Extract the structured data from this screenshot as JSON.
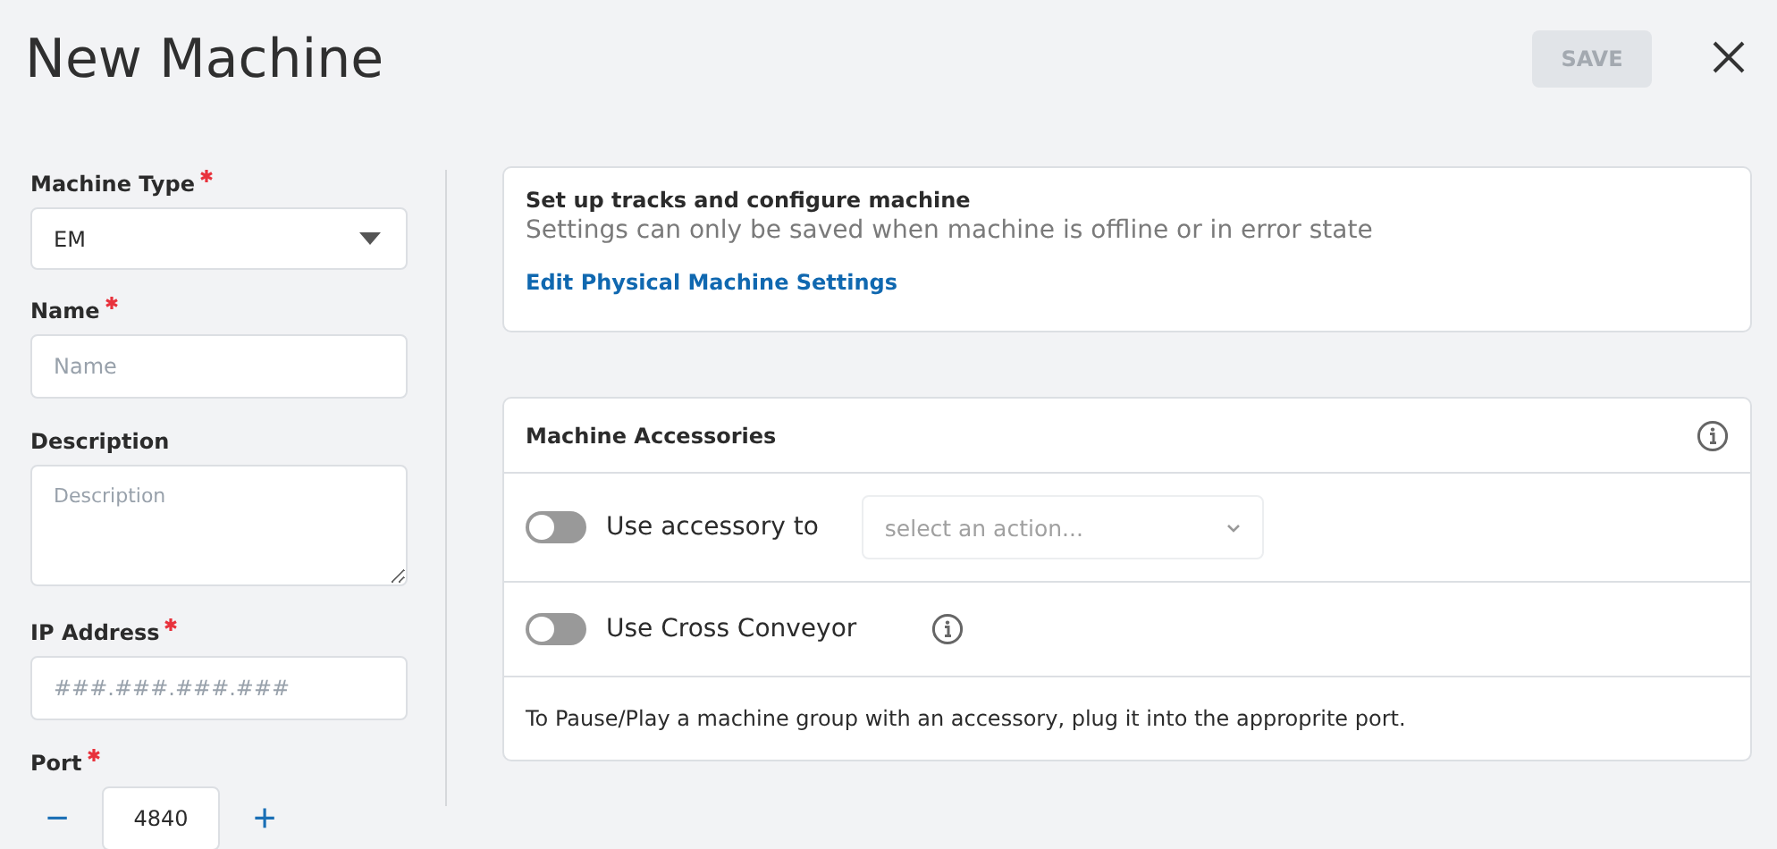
{
  "header": {
    "title": "New Machine",
    "save": {
      "label": "SAVE",
      "disabled": true
    }
  },
  "form": [
    {
      "kind": "select",
      "label": "Machine Type",
      "required": true,
      "value": "EM"
    },
    {
      "kind": "text",
      "label": "Name",
      "required": true,
      "placeholder": "Name"
    },
    {
      "kind": "textarea",
      "label": "Description",
      "required": false,
      "placeholder": "Description"
    },
    {
      "kind": "text",
      "label": "IP Address",
      "required": true,
      "placeholder": "###.###.###.###"
    },
    {
      "kind": "stepper",
      "label": "Port",
      "required": true,
      "value": "4840",
      "minus": "−",
      "plus": "+"
    }
  ],
  "settings_card": {
    "title": "Set up tracks and configure machine",
    "subtitle": "Settings can only be saved when machine is offline or in error state",
    "link": "Edit Physical Machine Settings"
  },
  "accessories": {
    "title": "Machine Accessories",
    "rows": [
      {
        "kind": "select",
        "label": "Use accessory to",
        "on": false,
        "placeholder": "select an action..."
      },
      {
        "kind": "info",
        "label": "Use Cross Conveyor",
        "on": false
      }
    ],
    "note": "To Pause/Play a machine group with an accessory, plug it into the approprite port."
  }
}
